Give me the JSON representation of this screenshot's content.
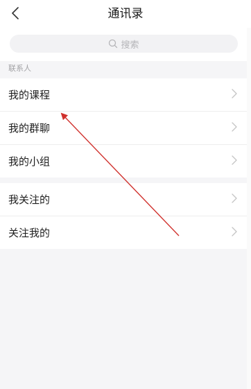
{
  "header": {
    "title": "通讯录",
    "back_icon": "chevron-left-icon"
  },
  "search": {
    "placeholder": "搜索",
    "icon": "search-icon"
  },
  "section": {
    "label": "联系人"
  },
  "groups": [
    {
      "items": [
        {
          "label": "我的课程",
          "icon": "chevron-right-icon"
        },
        {
          "label": "我的群聊",
          "icon": "chevron-right-icon"
        },
        {
          "label": "我的小组",
          "icon": "chevron-right-icon"
        }
      ]
    },
    {
      "items": [
        {
          "label": "我关注的",
          "icon": "chevron-right-icon"
        },
        {
          "label": "关注我的",
          "icon": "chevron-right-icon"
        }
      ]
    }
  ],
  "annotation": {
    "arrow_color": "#d0312d"
  }
}
